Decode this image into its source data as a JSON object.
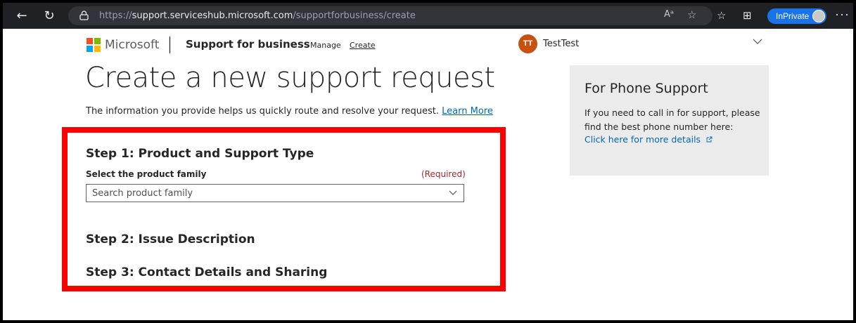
{
  "browser": {
    "url_prefix": "https://",
    "url_host": "support.serviceshub.microsoft.com",
    "url_path": "/supportforbusiness/create",
    "inprivate_label": "InPrivate",
    "read_aloud_glyph": "Aᵃ",
    "back_glyph": "←",
    "refresh_glyph": "↻",
    "menu_glyph": "···",
    "favorites_glyph": "☆",
    "collections_glyph": "⊞"
  },
  "header": {
    "company": "Microsoft",
    "brand": "Support for business",
    "nav": [
      {
        "label": "Manage"
      },
      {
        "label": "Create"
      }
    ],
    "user": {
      "initials": "TT",
      "name": "TestTest"
    },
    "logo_colors": [
      "#f25022",
      "#7fba00",
      "#00a4ef",
      "#ffb900"
    ]
  },
  "main": {
    "title": "Create a new support request",
    "intro_text": "The information you provide helps us quickly route and resolve your request.",
    "intro_link": "Learn More",
    "steps": [
      {
        "label": "Step 1: Product and Support Type"
      },
      {
        "label": "Step 2: Issue Description"
      },
      {
        "label": "Step 3: Contact Details and Sharing"
      }
    ],
    "product_field": {
      "label": "Select the product family",
      "required": "(Required)",
      "placeholder": "Search product family"
    }
  },
  "phone_panel": {
    "title": "For Phone Support",
    "text": "If you need to call in for support, please find the best phone number here:",
    "link": "Click here for more details"
  },
  "colors": {
    "highlight": "#ff0000",
    "link": "#0067b8",
    "avatar": "#ca5010",
    "required": "#a4262c"
  }
}
